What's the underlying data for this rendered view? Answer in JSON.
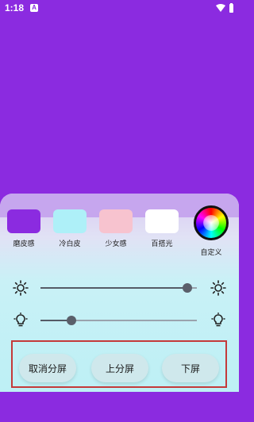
{
  "status_bar": {
    "time": "1:18",
    "notification_icon": "a-icon"
  },
  "filters": {
    "swatches": [
      {
        "label": "磨皮感",
        "color": "#8b2be0"
      },
      {
        "label": "冷白皮",
        "color": "#aef0f8"
      },
      {
        "label": "少女感",
        "color": "#f7c3cf"
      },
      {
        "label": "百搭光",
        "color": "#ffffff"
      }
    ],
    "custom": {
      "label": "自定义",
      "icon": "color-wheel-icon"
    }
  },
  "sliders": {
    "brightness": {
      "icon": "sun-icon",
      "value_fraction": 0.94
    },
    "warmth": {
      "icon": "bulb-icon",
      "value_fraction": 0.2
    }
  },
  "buttons": {
    "cancel_split": "取消分屏",
    "upper_screen": "上分屏",
    "lower_screen": "下屏"
  },
  "colors": {
    "background": "#8b2be0",
    "highlight_frame": "#c43a3a"
  }
}
